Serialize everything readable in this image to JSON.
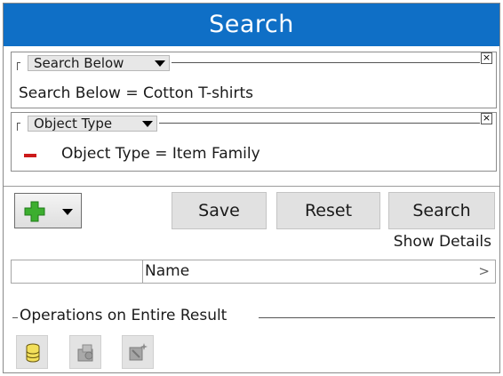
{
  "header": {
    "title": "Search"
  },
  "criteria": [
    {
      "dropdown_label": "Search Below",
      "text": "Search Below = Cotton T-shirts",
      "close_label": "×"
    },
    {
      "dropdown_label": "Object Type",
      "text": "Object Type = Item Family",
      "close_label": "×"
    }
  ],
  "toolbar": {
    "add_icon": "green-plus-icon",
    "save_label": "Save",
    "reset_label": "Reset",
    "search_label": "Search"
  },
  "show_details_label": "Show Details",
  "results": {
    "columns": [
      "Name"
    ],
    "scroll_label": ">"
  },
  "operations": {
    "label": "Operations on Entire Result",
    "icons": [
      "database-icon",
      "group-icon",
      "wand-icon"
    ]
  },
  "colors": {
    "header_bg": "#0f6fc6",
    "minus": "#cc1a1a",
    "plus": "#3cae2f"
  }
}
